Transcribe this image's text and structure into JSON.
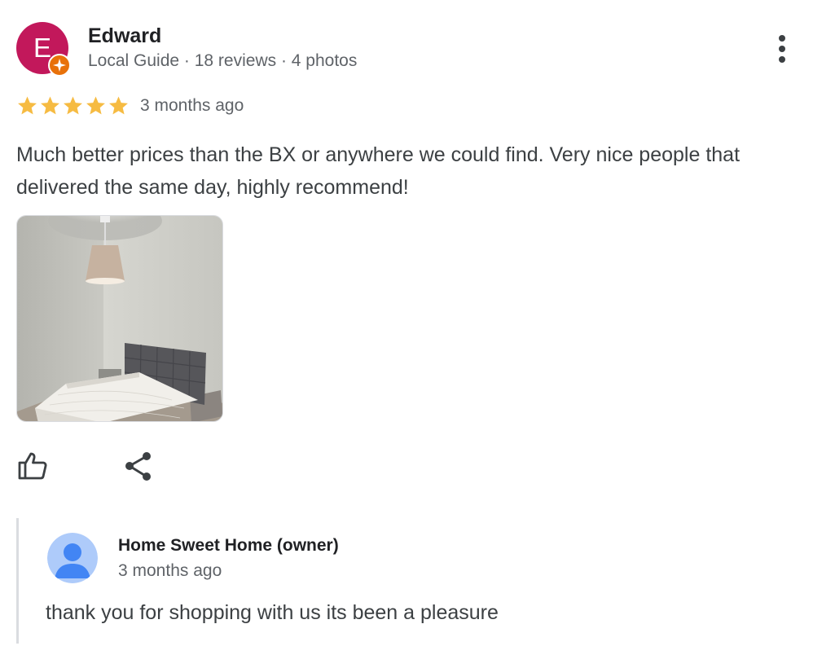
{
  "review": {
    "author": {
      "initial": "E",
      "name": "Edward",
      "meta": "Local Guide · 18 reviews · 4 photos",
      "avatar_color": "#c2185b",
      "badge_color": "#e8710a",
      "badge_icon": "local-guide-star-icon"
    },
    "more_icon": "more-vert-icon",
    "rating": {
      "stars": 5,
      "max": 5,
      "star_color": "#f6bb42"
    },
    "date": "3 months ago",
    "text": "Much better prices than the BX or anywhere we could find. Very nice people that delivered the same day, highly recommend!",
    "photos": [
      {
        "subject": "bedroom-photo"
      }
    ],
    "actions": {
      "like_icon": "thumbs-up-icon",
      "share_icon": "share-icon"
    }
  },
  "owner_reply": {
    "name": "Home Sweet Home (owner)",
    "date": "3 months ago",
    "text": "thank you for shopping with us its been a pleasure",
    "avatar_bg": "#aecbfa",
    "avatar_fg": "#4285f4"
  }
}
